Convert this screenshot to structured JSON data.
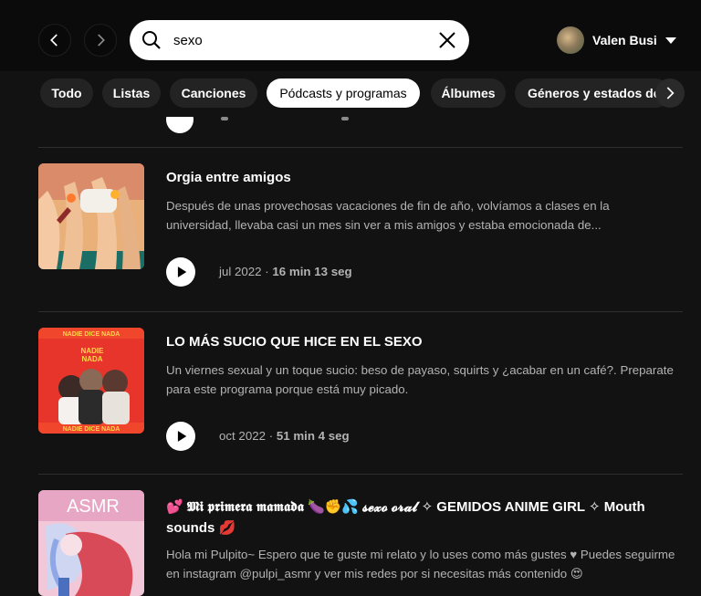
{
  "search": {
    "value": "sexo"
  },
  "user": {
    "name": "Valen Busi"
  },
  "filters": [
    "Todo",
    "Listas",
    "Canciones",
    "Pódcasts y programas",
    "Álbumes",
    "Géneros y estados de"
  ],
  "episodes": [
    {
      "title": "Orgia entre amigos",
      "description": "Después de unas provechosas vacaciones de fin de año, volvíamos a clases en la universidad, llevaba casi un mes sin ver a mis amigos y estaba emocionada de...",
      "date": "jul 2022",
      "separator": " · ",
      "duration": "16 min 13 seg"
    },
    {
      "title": "LO MÁS SUCIO QUE HICE EN EL SEXO",
      "description": "Un viernes sexual y un toque sucio: beso de payaso, squirts y ¿acabar en un café?. Preparate para este programa porque está muy picado.",
      "date": "oct 2022",
      "separator": " · ",
      "duration": "51 min 4 seg",
      "cover_text": "NADIE DICE NADA"
    },
    {
      "title": "💕 𝕸𝖎 𝖕𝖗𝖎𝖒𝖊𝖗𝖆 𝖒𝖆𝖒𝖆𝖉𝖆 🍆✊💦 𝓼𝓮𝔁𝓸 𝓸𝓻𝓪𝓵 ✧ GEMIDOS ANIME GIRL ✧ Mouth sounds 💋",
      "description": "Hola mi Pulpito~ Espero que te guste mi relato y lo uses como más gustes ♥ Puedes seguirme en instagram @pulpi_asmr y ver mis redes por si necesitas más contenido 😍",
      "cover_text": "ASMR"
    }
  ],
  "colors": {
    "background": "#121212",
    "topbar": "#0b0b0b",
    "chip": "#232323",
    "chip_active": "#ffffff",
    "muted_text": "#b3b3b3"
  }
}
